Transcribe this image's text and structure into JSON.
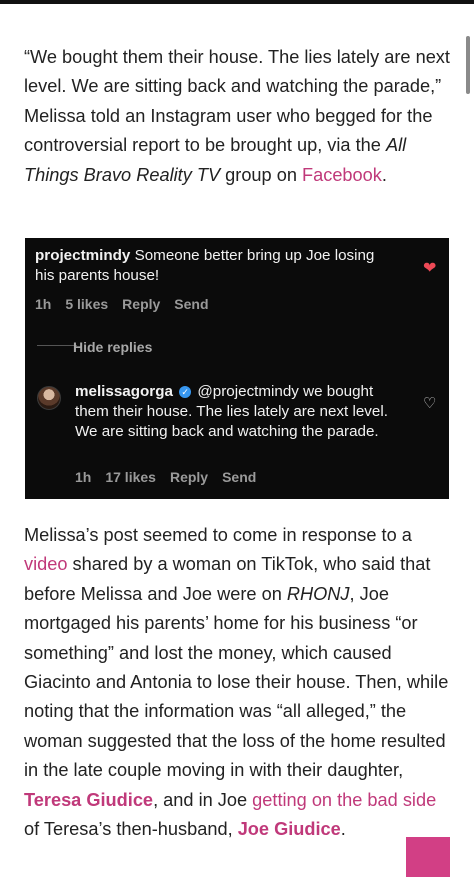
{
  "article": {
    "para1": {
      "text_before_italic": "“We bought them their house. The lies lately are next level. We are sitting back and watching the parade,” Melissa told an Instagram user who begged for the controversial report to be brought up, via the ",
      "italic": "All Things Bravo Reality TV",
      "text_after_italic": " group on ",
      "link": "Facebook",
      "end": "."
    },
    "para2": {
      "t1": "Melissa’s post seemed to come in response to a ",
      "link_video": "video",
      "t2": " shared by a woman on TikTok, who said that before Melissa and Joe were on ",
      "italic_rhonj": "RHONJ",
      "t3": ", Joe mortgaged his parents’ home for his business “or something” and lost the money, which caused Giacinto and Antonia to lose their house. Then, while noting that the information was “all alleged,” the woman suggested that the loss of the home resulted in the late couple moving in with their daughter, ",
      "link_teresa": "Teresa Giudice",
      "t4": ", and in Joe ",
      "link_badside": "getting on the bad side",
      "t5": " of Teresa’s then-husband, ",
      "link_joe": "Joe Giudice",
      "end": "."
    }
  },
  "instagram_screenshot": {
    "comment1": {
      "username": "projectmindy",
      "text": " Someone better bring up Joe losing his parents house!",
      "time": "1h",
      "likes": "5 likes",
      "reply": "Reply",
      "send": "Send",
      "liked": true
    },
    "hide_replies": "Hide replies",
    "comment2": {
      "username": "melissagorga",
      "verified": true,
      "mention": "@projectmindy",
      "text": " we bought them their house. The lies lately are next level. We are sitting back and watching the parade.",
      "time": "1h",
      "likes": "17 likes",
      "reply": "Reply",
      "send": "Send"
    }
  },
  "colors": {
    "link": "#c0397a",
    "heart_liked": "#ed4956",
    "verified_badge": "#3797f0",
    "pink_button": "#d23f85"
  },
  "icons": {
    "liked_heart": "heart-filled-icon",
    "like_heart": "heart-outline-icon",
    "verified": "verified-badge-icon"
  }
}
